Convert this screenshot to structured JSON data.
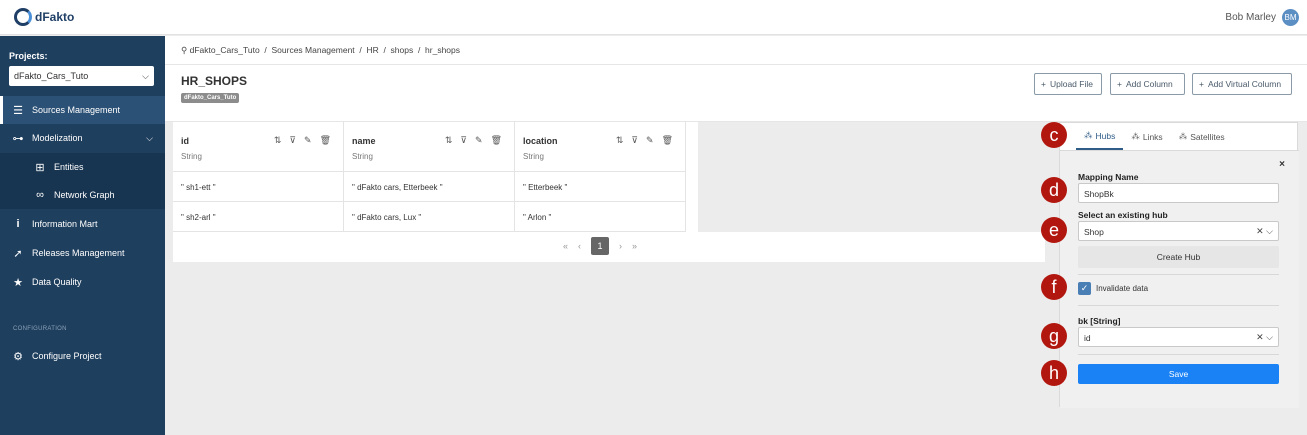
{
  "app": {
    "logo_text": "dFakto"
  },
  "user": {
    "name": "Bob Marley",
    "initials": "BM"
  },
  "sidebar": {
    "projects_label": "Projects:",
    "project_selected": "dFakto_Cars_Tuto",
    "items": [
      {
        "label": "Sources Management",
        "icon": "layers-icon"
      },
      {
        "label": "Modelization",
        "icon": "hierarchy-icon"
      },
      {
        "label": "Entities",
        "icon": "sitemap-icon"
      },
      {
        "label": "Network Graph",
        "icon": "binoculars-icon"
      },
      {
        "label": "Information Mart",
        "icon": "info-icon"
      },
      {
        "label": "Releases Management",
        "icon": "rocket-icon"
      },
      {
        "label": "Data Quality",
        "icon": "star-icon"
      }
    ],
    "config_heading": "CONFIGURATION",
    "configure_label": "Configure Project"
  },
  "breadcrumb": "dFakto_Cars_Tuto  /  Sources Management  /  HR  /  shops  /  hr_shops",
  "page": {
    "title": "HR_SHOPS",
    "tag": "dFakto_Cars_Tuto",
    "buttons": {
      "upload": "Upload File",
      "add_column": "Add Column",
      "add_virtual": "Add Virtual Column"
    }
  },
  "table": {
    "columns": [
      {
        "name": "id",
        "type": "String"
      },
      {
        "name": "name",
        "type": "String"
      },
      {
        "name": "location",
        "type": "String"
      }
    ],
    "rows": [
      [
        "\" sh1-ett \"",
        "\" dFakto cars, Etterbeek \"",
        "\" Etterbeek \""
      ],
      [
        "\" sh2-arl \"",
        "\" dFakto cars, Lux \"",
        "\" Arlon \""
      ]
    ]
  },
  "pagination": {
    "first": "«",
    "prev": "‹",
    "current": "1",
    "next": "›",
    "last": "»"
  },
  "panel": {
    "tabs": [
      "Hubs",
      "Links",
      "Satellites"
    ],
    "close": "×",
    "mapping_name_label": "Mapping Name",
    "mapping_name_value": "ShopBk",
    "hub_label": "Select an existing hub",
    "hub_value": "Shop",
    "create_hub": "Create Hub",
    "invalidate_label": "Invalidate data",
    "bk_label": "bk [String]",
    "bk_value": "id",
    "save": "Save"
  },
  "markers": [
    "c",
    "d",
    "e",
    "f",
    "g",
    "h"
  ],
  "colors": {
    "sidebar": "#1f3f5e",
    "accent": "#1a82f5",
    "marker": "#b2170f"
  }
}
